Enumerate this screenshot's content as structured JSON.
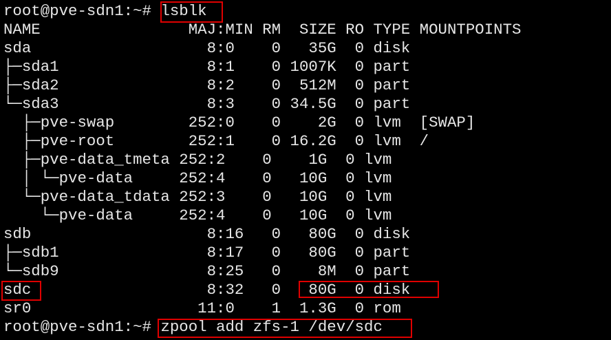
{
  "terminal": {
    "prompt": "root@pve-sdn1:~#",
    "command_1": "lsblk",
    "command_2": "zpool add zfs-1 /dev/sdc",
    "header": "NAME                MAJ:MIN RM  SIZE RO TYPE MOUNTPOINTS",
    "rows": [
      "sda                   8:0    0   35G  0 disk",
      "├─sda1                8:1    0 1007K  0 part",
      "├─sda2                8:2    0  512M  0 part",
      "└─sda3                8:3    0 34.5G  0 part",
      "  ├─pve-swap        252:0    0    2G  0 lvm  [SWAP]",
      "  ├─pve-root        252:1    0 16.2G  0 lvm  /",
      "  ├─pve-data_tmeta 252:2    0    1G  0 lvm",
      "  │ └─pve-data     252:4    0   10G  0 lvm",
      "  └─pve-data_tdata 252:3    0   10G  0 lvm",
      "    └─pve-data     252:4    0   10G  0 lvm",
      "sdb                   8:16   0   80G  0 disk",
      "├─sdb1                8:17   0   80G  0 part",
      "└─sdb9                8:25   0    8M  0 part",
      "sdc                   8:32   0   80G  0 disk",
      "sr0                  11:0    1  1.3G  0 rom"
    ]
  }
}
